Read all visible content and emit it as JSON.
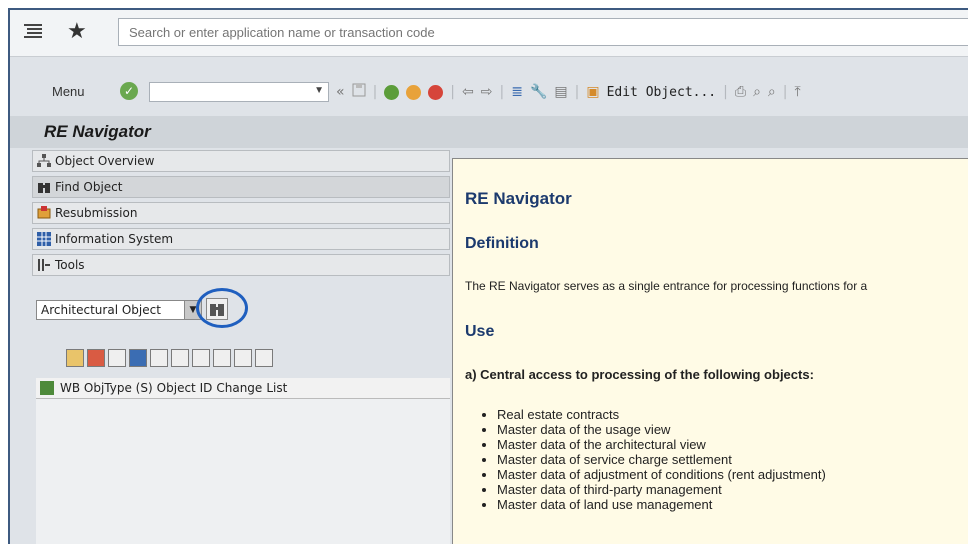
{
  "search": {
    "placeholder": "Search or enter application name or transaction code"
  },
  "toolbar": {
    "menu_label": "Menu",
    "edit_object_label": "Edit Object..."
  },
  "page": {
    "title": "RE Navigator"
  },
  "sidebar": {
    "items": [
      {
        "label": "Object Overview"
      },
      {
        "label": "Find Object"
      },
      {
        "label": "Resubmission"
      },
      {
        "label": "Information System"
      },
      {
        "label": "Tools"
      }
    ]
  },
  "object_type_select": {
    "value": "Architectural Object"
  },
  "worklist": {
    "columns": [
      "WB ObjType (S)",
      "Object ID",
      "Change",
      "List"
    ]
  },
  "help": {
    "title": "RE Navigator",
    "definition_heading": "Definition",
    "definition_text": "The RE Navigator serves as a single entrance for processing functions for a",
    "use_heading": "Use",
    "use_subheading": "a) Central access to processing of the following objects:",
    "objects": [
      "Real estate contracts",
      "Master data of the usage view",
      "Master data of the architectural view",
      "Master data of service charge settlement",
      "Master data of adjustment of conditions (rent adjustment)",
      "Master data of third-party management",
      "Master data of land use management"
    ]
  },
  "colors": {
    "accent": "#1c3a6e",
    "highlight": "#1f5fbf",
    "help_bg": "#fffbe6"
  }
}
